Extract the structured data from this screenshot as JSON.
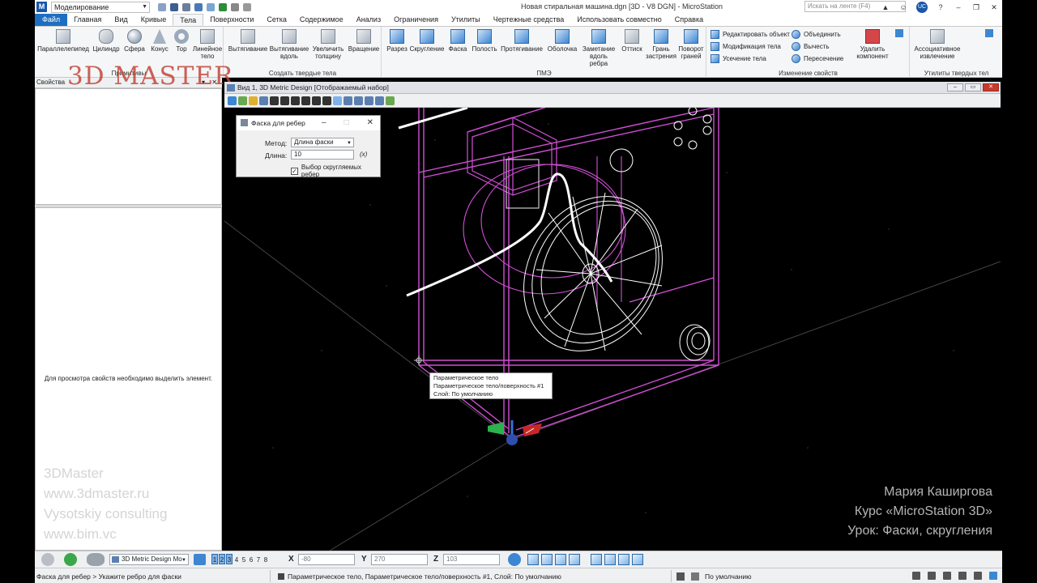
{
  "app": {
    "workspace": "Моделирование",
    "document_title": "Новая стиральная машина.dgn [3D - V8 DGN] - MicroStation",
    "search_placeholder": "Искать на ленте (F4)",
    "user_initials": "UC"
  },
  "ribbon_tabs": [
    "Файл",
    "Главная",
    "Вид",
    "Кривые",
    "Тела",
    "Поверхности",
    "Сетка",
    "Содержимое",
    "Анализ",
    "Ограничения",
    "Утилиты",
    "Чертежные средства",
    "Использовать совместно",
    "Справка"
  ],
  "ribbon": {
    "primitives": {
      "label": "Примитивы",
      "buttons": [
        "Параллелепипед",
        "Цилиндр",
        "Сфера",
        "Конус",
        "Тор",
        "Линейное тело"
      ]
    },
    "create_solids": {
      "label": "Создать твердые тела",
      "buttons": [
        "Вытягивание",
        "Вытягивание вдоль",
        "Увеличить толщину",
        "Вращение"
      ]
    },
    "pme": {
      "label": "ПМЭ",
      "buttons": [
        "Разрез",
        "Скругление",
        "Фаска",
        "Полость",
        "Протягивание",
        "Оболочка",
        "Заметание вдоль ребра",
        "Оттиск",
        "Грань застрения",
        "Поворот граней"
      ]
    },
    "modify": {
      "label": "Изменение свойств",
      "items": [
        "Редактировать объект",
        "Модификация тела",
        "Усечение тела",
        "Объединить",
        "Вычесть",
        "Пересечение"
      ],
      "delete_component": "Удалить компонент"
    },
    "utilities": {
      "label": "Утилиты твердых тел",
      "button": "Ассоциативное извлечение"
    }
  },
  "properties_panel": {
    "title": "Свойства",
    "message": "Для просмотра свойств необходимо выделить элемент."
  },
  "watermarks": {
    "logo": "3D MASTER",
    "left": [
      "3DMaster",
      "www.3dmaster.ru",
      "Vysotskiy consulting",
      "www.bim.vc"
    ],
    "right": [
      "Мария Каширгова",
      "Курс «MicroStation 3D»",
      "Урок: Фаски, скругления"
    ]
  },
  "view": {
    "title": "Вид 1, 3D Metric Design [Отображаемый набор]"
  },
  "chamfer_dialog": {
    "title": "Фаска для ребер",
    "method_label": "Метод:",
    "method_value": "Длина фаски",
    "length_label": "Длина:",
    "length_value": "10",
    "fx": "(x)",
    "checkbox_label": "Выбор скругляемых ребер",
    "checkbox_checked": true
  },
  "tooltip": {
    "lines": [
      "Параметрическое тело",
      "Параметрическое тело/поверхность #1",
      "Слой: По умолчанию"
    ]
  },
  "bottom_toolbar": {
    "design_model": "3D Metric Design Mo",
    "view_numbers": [
      "1",
      "2",
      "3",
      "4",
      "5",
      "6",
      "7",
      "8"
    ],
    "active_views": [
      "1",
      "2",
      "3"
    ],
    "x_label": "X",
    "x_value": "-80",
    "y_label": "Y",
    "y_value": "270",
    "z_label": "Z",
    "z_value": "103"
  },
  "status_bar": {
    "prompt": "Фаска для ребер > Укажите ребро для фаски",
    "info": "Параметрическое тело, Параметрическое тело/поверхность #1, Слой: По умолчанию",
    "level": "По умолчанию"
  },
  "colors": {
    "accent": "#1e6fc1",
    "canvas_bg": "#000000",
    "geometry_magenta": "#d24fd6",
    "geometry_white": "#ffffff"
  }
}
